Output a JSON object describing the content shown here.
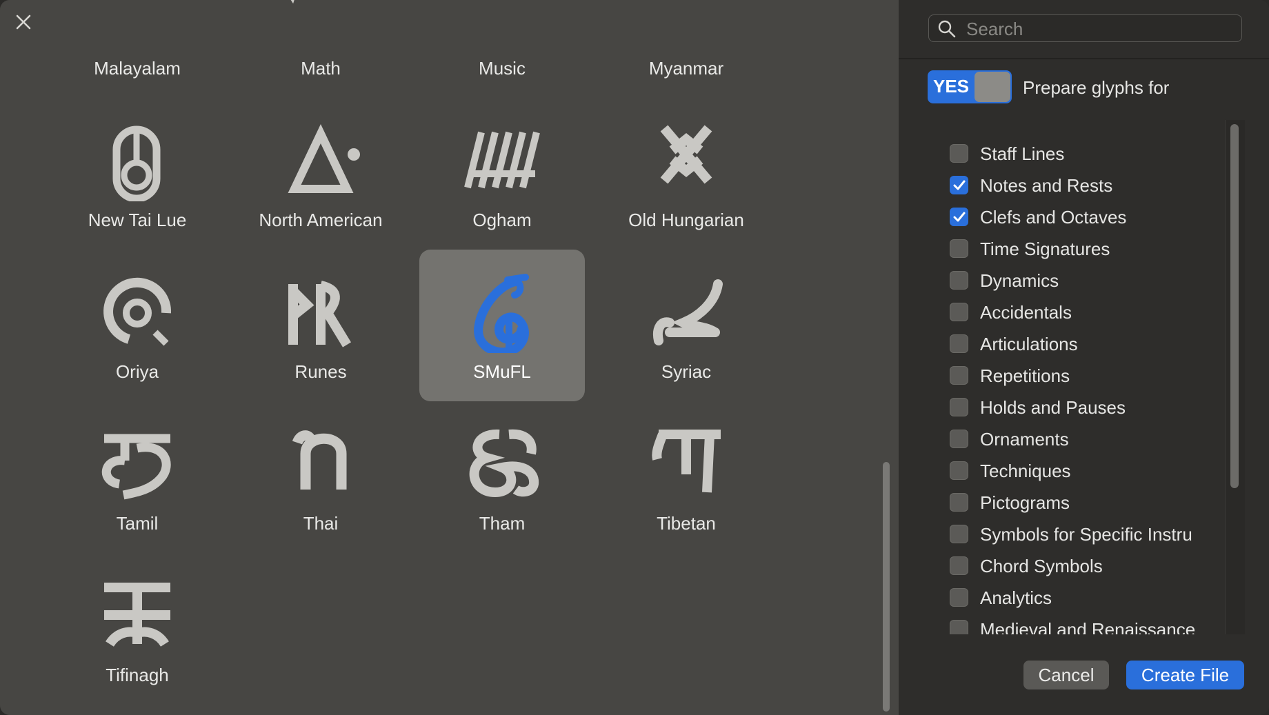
{
  "scripts": [
    {
      "label": "Malayalam",
      "icon": "malayalam-glyph-icon",
      "selected": false
    },
    {
      "label": "Math",
      "icon": "math-glyph-icon",
      "selected": false
    },
    {
      "label": "Music",
      "icon": "music-glyph-icon",
      "selected": false
    },
    {
      "label": "Myanmar",
      "icon": "myanmar-glyph-icon",
      "selected": false
    },
    {
      "label": "New Tai Lue",
      "icon": "new-tai-lue-glyph-icon",
      "selected": false
    },
    {
      "label": "North American",
      "icon": "north-american-glyph-icon",
      "selected": false
    },
    {
      "label": "Ogham",
      "icon": "ogham-glyph-icon",
      "selected": false
    },
    {
      "label": "Old Hungarian",
      "icon": "old-hungarian-glyph-icon",
      "selected": false
    },
    {
      "label": "Oriya",
      "icon": "oriya-glyph-icon",
      "selected": false
    },
    {
      "label": "Runes",
      "icon": "runes-glyph-icon",
      "selected": false
    },
    {
      "label": "SMuFL",
      "icon": "smufl-glyph-icon",
      "selected": true
    },
    {
      "label": "Syriac",
      "icon": "syriac-glyph-icon",
      "selected": false
    },
    {
      "label": "Tamil",
      "icon": "tamil-glyph-icon",
      "selected": false
    },
    {
      "label": "Thai",
      "icon": "thai-glyph-icon",
      "selected": false
    },
    {
      "label": "Tham",
      "icon": "tham-glyph-icon",
      "selected": false
    },
    {
      "label": "Tibetan",
      "icon": "tibetan-glyph-icon",
      "selected": false
    },
    {
      "label": "Tifinagh",
      "icon": "tifinagh-glyph-icon",
      "selected": false
    }
  ],
  "search": {
    "placeholder": "Search",
    "value": ""
  },
  "toggle": {
    "state_label": "YES",
    "on": true,
    "label": "Prepare glyphs for"
  },
  "categories": [
    {
      "label": "Staff Lines",
      "checked": false
    },
    {
      "label": "Notes and Rests",
      "checked": true
    },
    {
      "label": "Clefs and Octaves",
      "checked": true
    },
    {
      "label": "Time Signatures",
      "checked": false
    },
    {
      "label": "Dynamics",
      "checked": false
    },
    {
      "label": "Accidentals",
      "checked": false
    },
    {
      "label": "Articulations",
      "checked": false
    },
    {
      "label": "Repetitions",
      "checked": false
    },
    {
      "label": "Holds and Pauses",
      "checked": false
    },
    {
      "label": "Ornaments",
      "checked": false
    },
    {
      "label": "Techniques",
      "checked": false
    },
    {
      "label": "Pictograms",
      "checked": false
    },
    {
      "label": "Symbols for Specific Instru",
      "checked": false
    },
    {
      "label": "Chord Symbols",
      "checked": false
    },
    {
      "label": "Analytics",
      "checked": false
    },
    {
      "label": "Medieval and Renaissance",
      "checked": false
    }
  ],
  "buttons": {
    "cancel": "Cancel",
    "create": "Create File"
  },
  "colors": {
    "accent": "#2a6fdb",
    "glyph": "#c9c8c4",
    "selected_bg": "#74736f"
  }
}
